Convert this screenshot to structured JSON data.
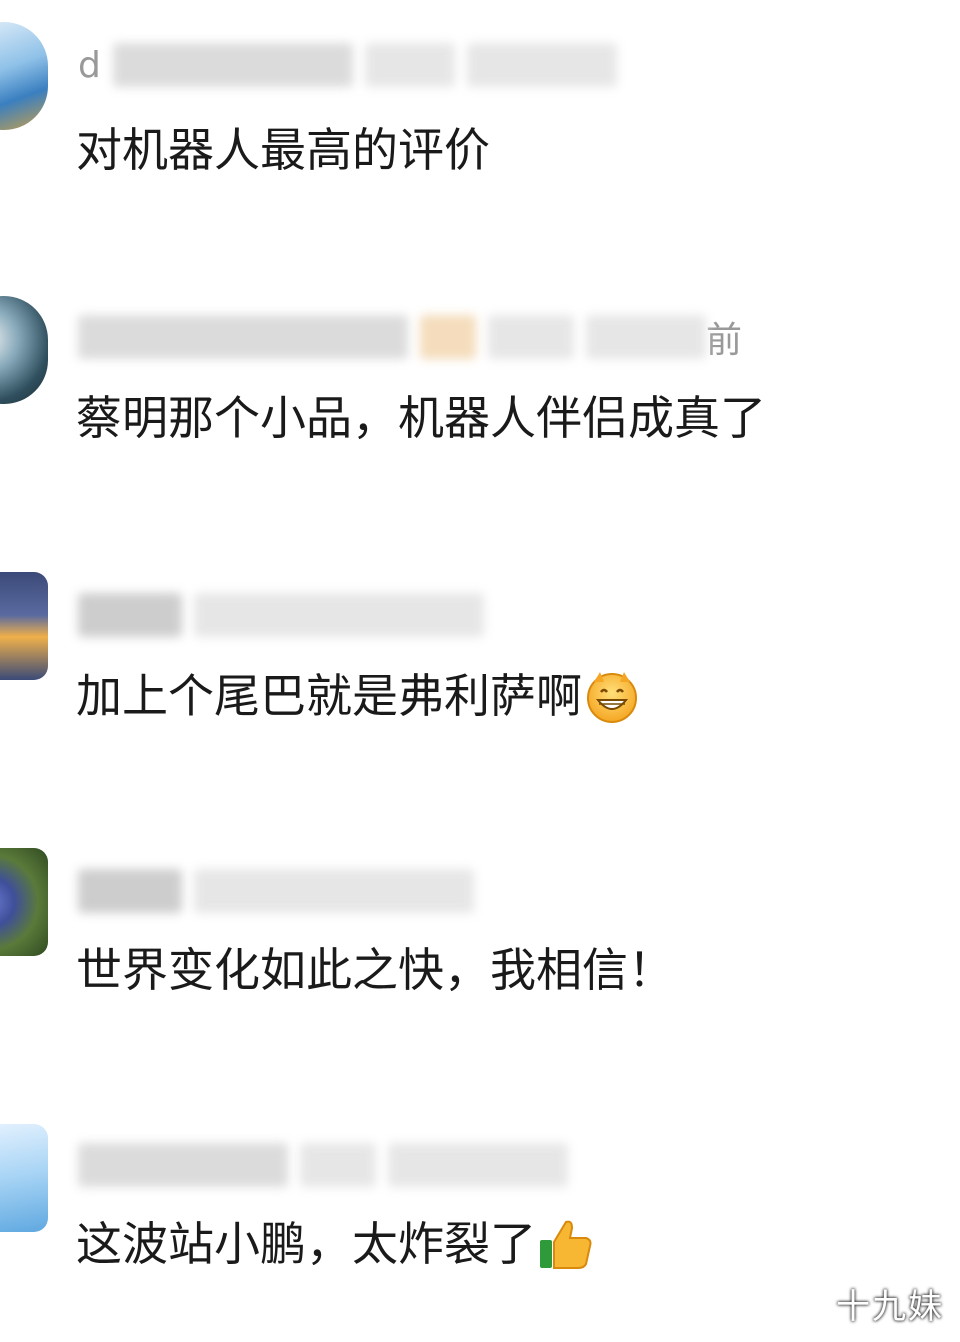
{
  "comments": [
    {
      "name_hint": "d",
      "meta_suffix": "",
      "text": "对机器人最高的评价",
      "emoji": ""
    },
    {
      "name_hint": "",
      "meta_suffix": "前",
      "text": "蔡明那个小品，机器人伴侣成真了",
      "emoji": ""
    },
    {
      "name_hint": "",
      "meta_suffix": "",
      "text": "加上个尾巴就是弗利萨啊",
      "emoji": "grin-face-icon"
    },
    {
      "name_hint": "",
      "meta_suffix": "",
      "text": "世界变化如此之快，我相信！",
      "emoji": ""
    },
    {
      "name_hint": "",
      "meta_suffix": "",
      "text": "这波站小鹏，太炸裂了",
      "emoji": "thumbs-up-icon"
    }
  ],
  "watermark": "十九妹",
  "colors": {
    "background": "#ffffff",
    "text": "#1a1a1a",
    "meta": "#999999"
  }
}
